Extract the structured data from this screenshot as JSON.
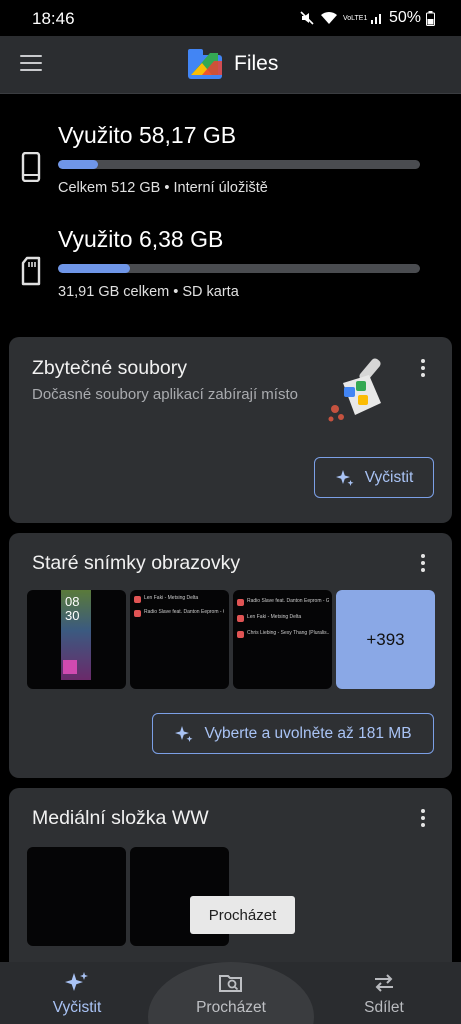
{
  "status": {
    "time": "18:46",
    "battery": "50%",
    "network": "VoLTE1"
  },
  "app": {
    "title": "Files"
  },
  "storage": [
    {
      "used": "Využito 58,17 GB",
      "detail": "Celkem 512 GB • Interní úložiště",
      "fraction": 0.11
    },
    {
      "used": "Využito 6,38 GB",
      "detail": "31,91 GB celkem • SD karta",
      "fraction": 0.2
    }
  ],
  "cards": {
    "junk": {
      "title": "Zbytečné soubory",
      "subtitle": "Dočasné soubory aplikací zabírají místo",
      "button": "Vyčistit"
    },
    "screenshots": {
      "title": "Staré snímky obrazovky",
      "thumb1_time_h": "08",
      "thumb1_time_m": "30",
      "thumb2_rows": [
        "Len Faki - Metsing Delta",
        "Radio Slave feat. Danton Eeprom - Grr..."
      ],
      "thumb3_rows": [
        "Radio Slave feat. Danton Eeprom - Gr...",
        "Len Faki - Metsing Delta",
        "Chris Liebing - Sexy Thang (Pluralis..."
      ],
      "more_count": "+393",
      "button": "Vyberte a uvolněte až 181 MB"
    },
    "media": {
      "title": "Mediální složka WW"
    }
  },
  "toast": "Procházet",
  "nav": [
    {
      "label": "Vyčistit",
      "icon": "sparkle-icon",
      "active": true
    },
    {
      "label": "Procházet",
      "icon": "browse-folder-icon",
      "active": false
    },
    {
      "label": "Sdílet",
      "icon": "share-swap-icon",
      "active": false
    }
  ],
  "colors": {
    "accent": "#a9c3f5",
    "bar_fill": "#6f96e8",
    "card_bg": "#2e3033"
  }
}
